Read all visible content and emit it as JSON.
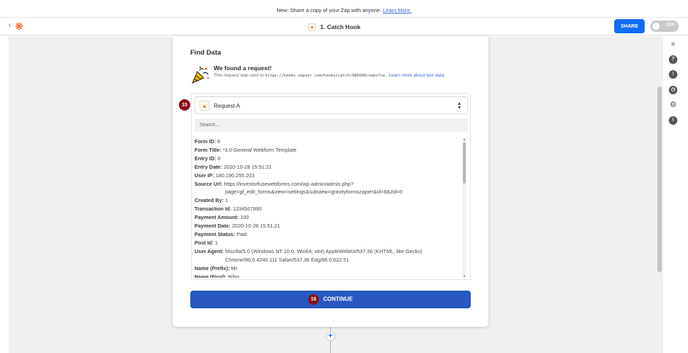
{
  "banner": {
    "text": "New: Share a copy of your Zap with anyone.",
    "link": "Learn More."
  },
  "topbar": {
    "back_icon": "chevron-left-icon",
    "logo": "zapier-logo",
    "zap_title": "1. Catch Hook",
    "share_label": "SHARE",
    "toggle_label": "OFF"
  },
  "card": {
    "title": "Find Data",
    "found_heading": "We found a request!",
    "found_text_prefix": "This request was sent to",
    "found_url": "https://hooks.zapier.com/hooks/catch/985690/oqkx7ce.",
    "found_link": "Learn more about test data.",
    "request_badge": "15",
    "request_label": "Request A",
    "search_placeholder": "Search...",
    "fields": [
      {
        "k": "Form ID:",
        "v": "8"
      },
      {
        "k": "Form Title:",
        "v": "*3.0 General Webform Template"
      },
      {
        "k": "Entry ID:",
        "v": "0"
      },
      {
        "k": "Entry Date:",
        "v": "2020-10-28 15:51:21"
      },
      {
        "k": "User IP:",
        "v": "180.190.255.203"
      },
      {
        "k": "Source Url:",
        "v": "https://investorfusewebforms.com/wp-admin/admin.php?",
        "cont": "page=gf_edit_forms&view=settings&subview=gravityformszapier&id=8&zid=0"
      },
      {
        "k": "Created By:",
        "v": "1"
      },
      {
        "k": "Transaction Id:",
        "v": "1234567890"
      },
      {
        "k": "Payment Amount:",
        "v": "100"
      },
      {
        "k": "Payment Date:",
        "v": "2020-10-28 15:51:21"
      },
      {
        "k": "Payment Status:",
        "v": "Paid"
      },
      {
        "k": "Post Id:",
        "v": "1"
      },
      {
        "k": "User Agent:",
        "v": "Mozilla/5.0 (Windows NT 10.0; Win64; x64) AppleWebKit/537.36 (KHTML, like Gecko)",
        "cont": "Chrome/86.0.4240.111 Safari/537.36 Edg/86.0.622.51"
      },
      {
        "k": "Name (Prefix):",
        "v": "Mr."
      },
      {
        "k": "Name (First):",
        "v": "Bilbo"
      }
    ],
    "continue_badge": "16",
    "continue_label": "CONTINUE"
  },
  "sidebar": {
    "icons": [
      "notes-icon",
      "help-icon",
      "alert-icon",
      "clock-icon",
      "gear-icon",
      "info-icon"
    ]
  }
}
